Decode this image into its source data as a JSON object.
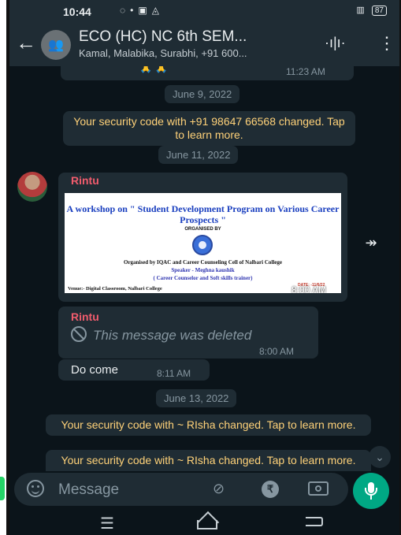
{
  "status_bar": {
    "time": "10:44",
    "network": "4G",
    "notification_icons": [
      "whatsapp-icon",
      "dot-icon",
      "facebook-icon",
      "alert-icon"
    ],
    "battery": "87"
  },
  "header": {
    "group_name": "ECO (HC) NC 6th SEM...",
    "participants": "Kamal, Malabika, Surabhi, +91 600..."
  },
  "messages": {
    "prev_time": "11:23 AM",
    "prev_emoji": "🙏 🙏",
    "date_june9": "June 9, 2022",
    "security_1": "Your security code with +91 98647 66568 changed. Tap to learn more.",
    "date_june11": "June 11, 2022",
    "image_msg": {
      "sender": "Rintu",
      "time": "8:00 AM",
      "poster": {
        "title": "A workshop on \" Student Development Program on Various Career Prospects \"",
        "organised_by": "ORGANISED BY",
        "organised_line": "Organised by IQAC and Career Counseling Cell of Nalbari College",
        "speaker": "Speaker - Meghna kaushik",
        "speaker_role": "( Career Counselor and Soft skills trainer)",
        "venue": "Venue:- Digital Classroom, Nalbari College",
        "date": "DATE: -11/6/22"
      }
    },
    "deleted_msg": {
      "sender": "Rintu",
      "text": "This message was deleted",
      "time": "8:00 AM"
    },
    "text_msg": {
      "text": "Do come",
      "time": "8:11 AM"
    },
    "date_june13": "June 13, 2022",
    "security_2": "Your security code with ~ RIsha changed. Tap to learn more.",
    "security_3": "Your security code with ~ RIsha changed. Tap to learn more."
  },
  "composer": {
    "placeholder": "Message",
    "rupee_symbol": "₹"
  },
  "colors": {
    "background": "#0b141a",
    "bubble": "#1f2c34",
    "system_text": "#ffd279",
    "sender_name": "#f15c6d",
    "accent": "#00a884"
  }
}
